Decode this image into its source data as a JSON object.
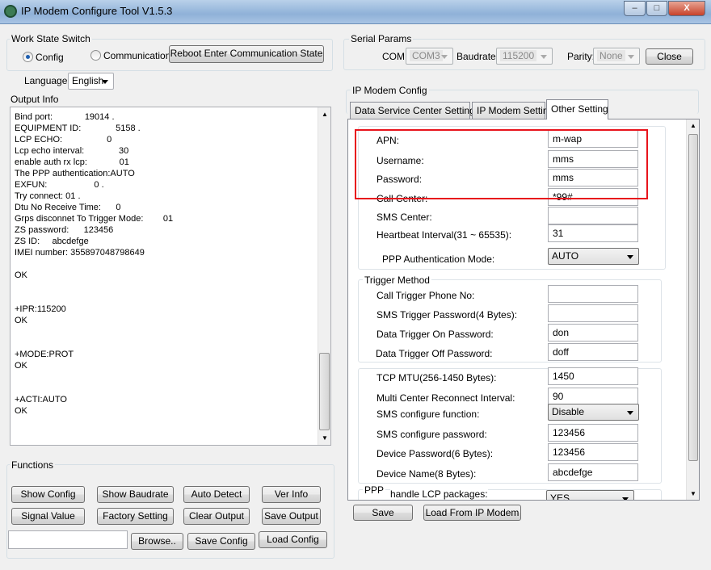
{
  "window": {
    "title": "IP Modem Configure Tool V1.5.3",
    "min": "–",
    "max": "□",
    "close": "X"
  },
  "work_state": {
    "label": "Work State Switch",
    "config": "Config",
    "communication": "Communication",
    "reboot": "Reboot Enter Communication State",
    "selected": "Config"
  },
  "language": {
    "label": "Language",
    "value": "English"
  },
  "output": {
    "label": "Output Info",
    "lines": [
      "Bind port:             19014 .",
      "EQUIPMENT ID:              5158 .",
      "LCP ECHO:                  0",
      "Lcp echo interval:              30",
      "enable auth rx lcp:             01",
      "The PPP authentication:AUTO",
      "EXFUN:                   0 .",
      "Try connect: 01 .",
      "Dtu No Receive Time:      0",
      "Grps disconnet To Trigger Mode:        01",
      "ZS password:      123456",
      "ZS ID:     abcdefge",
      "IMEI number: 355897048798649",
      "",
      "OK",
      "",
      "",
      "+IPR:115200",
      "OK",
      "",
      "",
      "+MODE:PROT",
      "OK",
      "",
      "",
      "+ACTI:AUTO",
      "OK"
    ]
  },
  "functions": {
    "label": "Functions",
    "buttons": [
      "Show Config",
      "Show Baudrate",
      "Auto Detect",
      "Ver Info",
      "Signal Value",
      "Factory Setting",
      "Clear Output",
      "Save Output"
    ],
    "path_value": "",
    "browse": "Browse..",
    "save_config": "Save Config",
    "load_config": "Load Config"
  },
  "serial": {
    "label": "Serial Params",
    "com_label": "COM:",
    "com": "COM3",
    "baud_label": "Baudrate:",
    "baud": "115200",
    "parity_label": "Parity:",
    "parity": "None",
    "close": "Close"
  },
  "config": {
    "label": "IP Modem Config",
    "tabs": [
      "Data Service Center Settings",
      "IP Modem Setting",
      "Other Setting"
    ],
    "active_tab": "Other Setting",
    "fields1": [
      {
        "label": "APN:",
        "value": "m-wap"
      },
      {
        "label": "Username:",
        "value": "mms"
      },
      {
        "label": "Password:",
        "value": "mms"
      },
      {
        "label": "Call Center:",
        "value": "*99#"
      },
      {
        "label": "SMS Center:",
        "value": ""
      },
      {
        "label": "Heartbeat Interval(31 ~ 65535):",
        "value": "31"
      }
    ],
    "ppp_auth": {
      "label": "PPP Authentication Mode:",
      "value": "AUTO"
    },
    "trigger": {
      "label": "Trigger Method",
      "fields": [
        {
          "label": "Call Trigger Phone No:",
          "value": ""
        },
        {
          "label": "SMS Trigger Password(4 Bytes):",
          "value": ""
        },
        {
          "label": "Data Trigger On Password:",
          "value": "don"
        },
        {
          "label": "Data Trigger Off Password:",
          "value": "doff"
        }
      ]
    },
    "fields3": [
      {
        "label": "TCP MTU(256-1450 Bytes):",
        "value": "1450"
      },
      {
        "label": "Multi Center Reconnect Interval:",
        "value": "90"
      },
      {
        "label": "SMS configure function:",
        "value": "Disable",
        "select": true
      },
      {
        "label": "SMS configure password:",
        "value": "123456"
      },
      {
        "label": "Device Password(6 Bytes):",
        "value": "123456"
      },
      {
        "label": "Device Name(8 Bytes):",
        "value": "abcdefge"
      }
    ],
    "ppp": {
      "label": "PPP",
      "handle_label": "handle LCP packages:",
      "handle_value": "YES"
    },
    "save": "Save",
    "load": "Load From IP Modem"
  },
  "colors": {
    "highlight": "#e8141c",
    "titlebar": "#9dbbe0"
  }
}
